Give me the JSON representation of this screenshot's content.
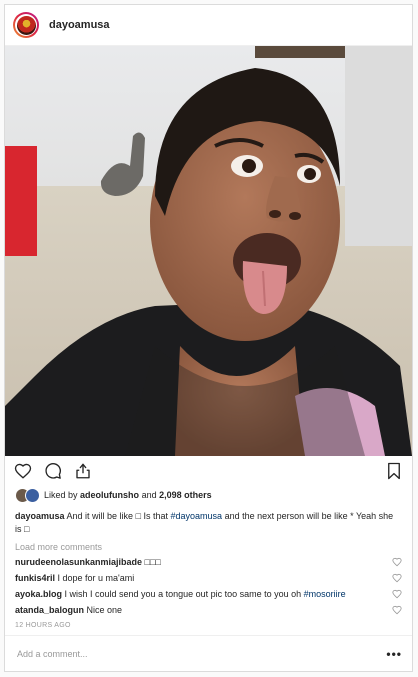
{
  "header": {
    "username": "dayoamusa"
  },
  "likes": {
    "prefix": "Liked by ",
    "user": "adeolufunsho",
    "middle": " and ",
    "count": "2,098 others"
  },
  "caption": {
    "username": "dayoamusa",
    "text_before_tag": " And it will be like □ Is that ",
    "tag": "#dayoamusa",
    "text_after_tag": " and the next person will be like * Yeah she is □"
  },
  "load_more": "Load more comments",
  "comments": [
    {
      "username": "nurudeenolasunkanmiajibade",
      "text": " □□□",
      "tag": ""
    },
    {
      "username": "funkis4ril",
      "text": " I dope for u ma'ami",
      "tag": ""
    },
    {
      "username": "ayoka.blog",
      "text": " I wish I could send you a tongue out pic too same to you oh ",
      "tag": "#mosoriire"
    },
    {
      "username": "atanda_balogun",
      "text": " Nice one",
      "tag": ""
    }
  ],
  "timestamp": "12 HOURS AGO",
  "add_comment": {
    "placeholder": "Add a comment...",
    "more": "•••"
  },
  "icons": {
    "like": "heart-icon",
    "comment": "comment-bubble-icon",
    "share": "share-icon",
    "save": "bookmark-icon"
  }
}
